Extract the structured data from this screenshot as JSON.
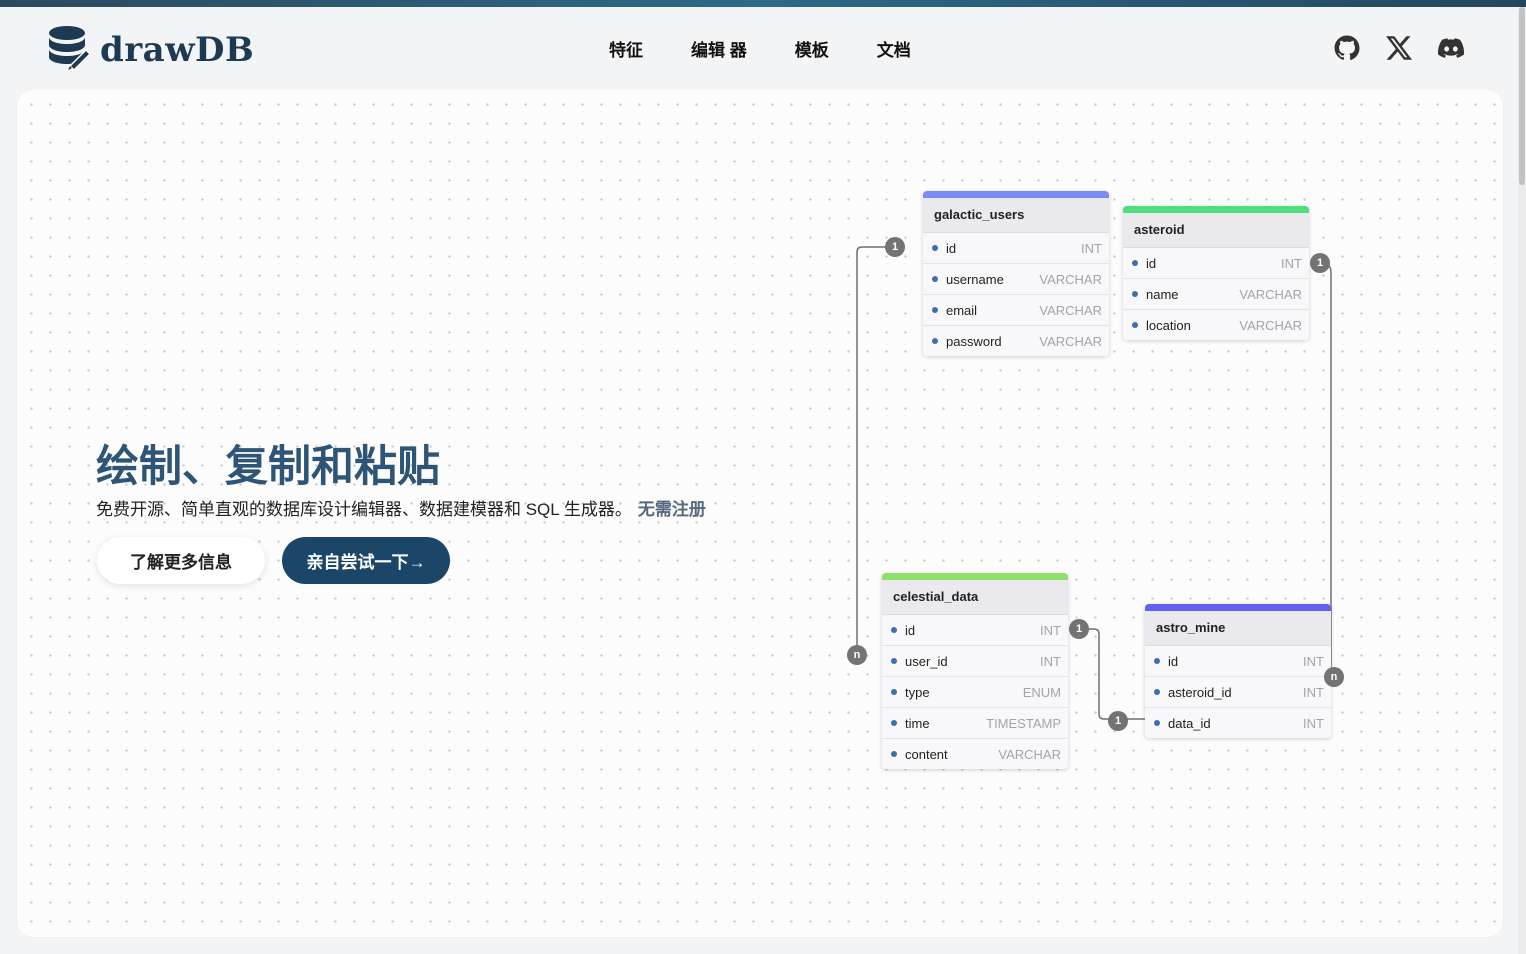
{
  "brand": {
    "name": "drawDB"
  },
  "nav": {
    "items": [
      "特征",
      "编辑 器",
      "模板",
      "文档"
    ]
  },
  "socials": [
    "github-icon",
    "x-icon",
    "discord-icon"
  ],
  "hero": {
    "title": "绘制、复制和粘贴",
    "subtitle": "免费开源、简单直观的数据库设计编辑器、数据建模器和 SQL 生成器。",
    "subtitle_link": "无需注册",
    "learn_more": "了解更多信息",
    "try_it": "亲自尝试一下→"
  },
  "tables": {
    "galactic_users": {
      "name": "galactic_users",
      "color": "#7b8df5",
      "fields": [
        {
          "name": "id",
          "type": "INT"
        },
        {
          "name": "username",
          "type": "VARCHAR"
        },
        {
          "name": "email",
          "type": "VARCHAR"
        },
        {
          "name": "password",
          "type": "VARCHAR"
        }
      ]
    },
    "asteroid": {
      "name": "asteroid",
      "color": "#4ede7e",
      "fields": [
        {
          "name": "id",
          "type": "INT"
        },
        {
          "name": "name",
          "type": "VARCHAR"
        },
        {
          "name": "location",
          "type": "VARCHAR"
        }
      ]
    },
    "celestial_data": {
      "name": "celestial_data",
      "color": "#8ee06a",
      "fields": [
        {
          "name": "id",
          "type": "INT"
        },
        {
          "name": "user_id",
          "type": "INT"
        },
        {
          "name": "type",
          "type": "ENUM"
        },
        {
          "name": "time",
          "type": "TIMESTAMP"
        },
        {
          "name": "content",
          "type": "VARCHAR"
        }
      ]
    },
    "astro_mine": {
      "name": "astro_mine",
      "color": "#6161f0",
      "fields": [
        {
          "name": "id",
          "type": "INT"
        },
        {
          "name": "asteroid_id",
          "type": "INT"
        },
        {
          "name": "data_id",
          "type": "INT"
        }
      ]
    }
  },
  "cardinality": {
    "one": "1",
    "many": "n"
  }
}
